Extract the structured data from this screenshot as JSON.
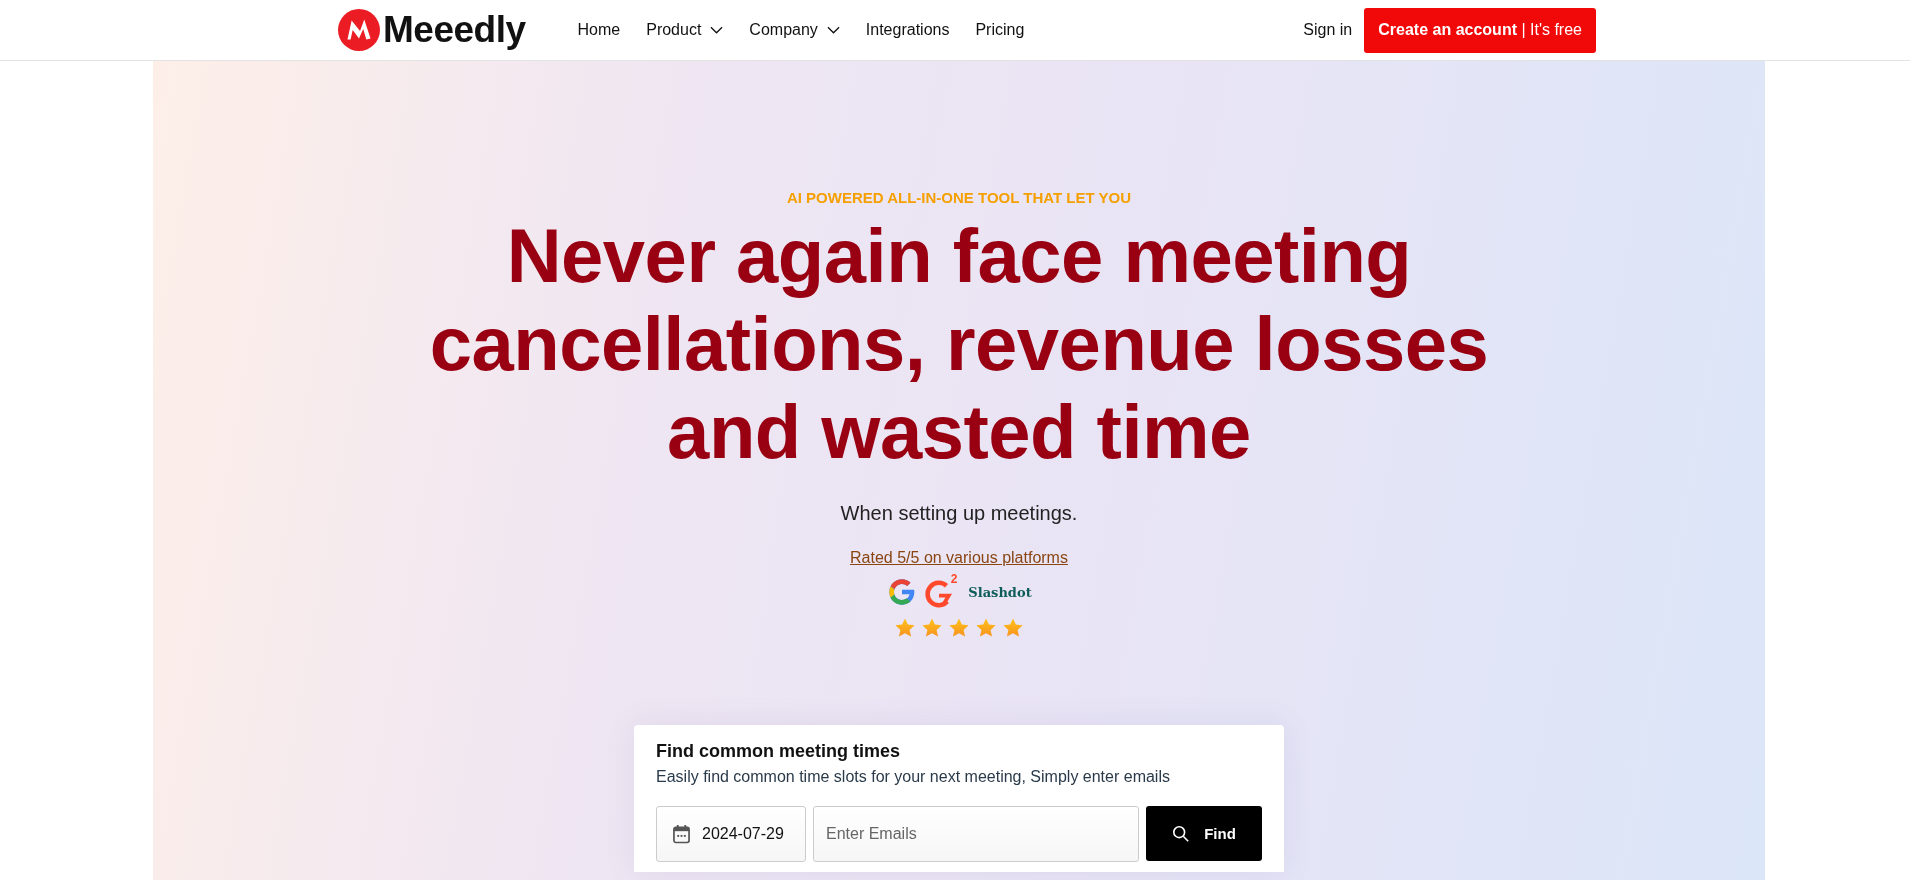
{
  "header": {
    "brand": "Meeedly",
    "nav": [
      {
        "label": "Home",
        "dropdown": false
      },
      {
        "label": "Product",
        "dropdown": true
      },
      {
        "label": "Company",
        "dropdown": true
      },
      {
        "label": "Integrations",
        "dropdown": false
      },
      {
        "label": "Pricing",
        "dropdown": false
      }
    ],
    "sign_in": "Sign in",
    "cta": "**Create an account** | It's free"
  },
  "hero": {
    "eyebrow": "AI POWERED ALL-IN-ONE TOOL THAT LET YOU",
    "headline": "Never again face meeting cancellations, revenue losses and wasted time",
    "subtitle": "When setting up meetings.",
    "rating_link": "Rated 5/5 on various platforms",
    "platforms": [
      {
        "kind": "google"
      },
      {
        "kind": "g2",
        "label": "2"
      },
      {
        "kind": "wordmark",
        "label": "Slashdot"
      }
    ],
    "stars": 5
  },
  "finder": {
    "title": "Find common meeting times",
    "description": "Easily find common time slots for your next meeting, Simply enter emails",
    "date": "2024-07-29",
    "emails_placeholder": "Enter Emails",
    "button": "Find"
  }
}
